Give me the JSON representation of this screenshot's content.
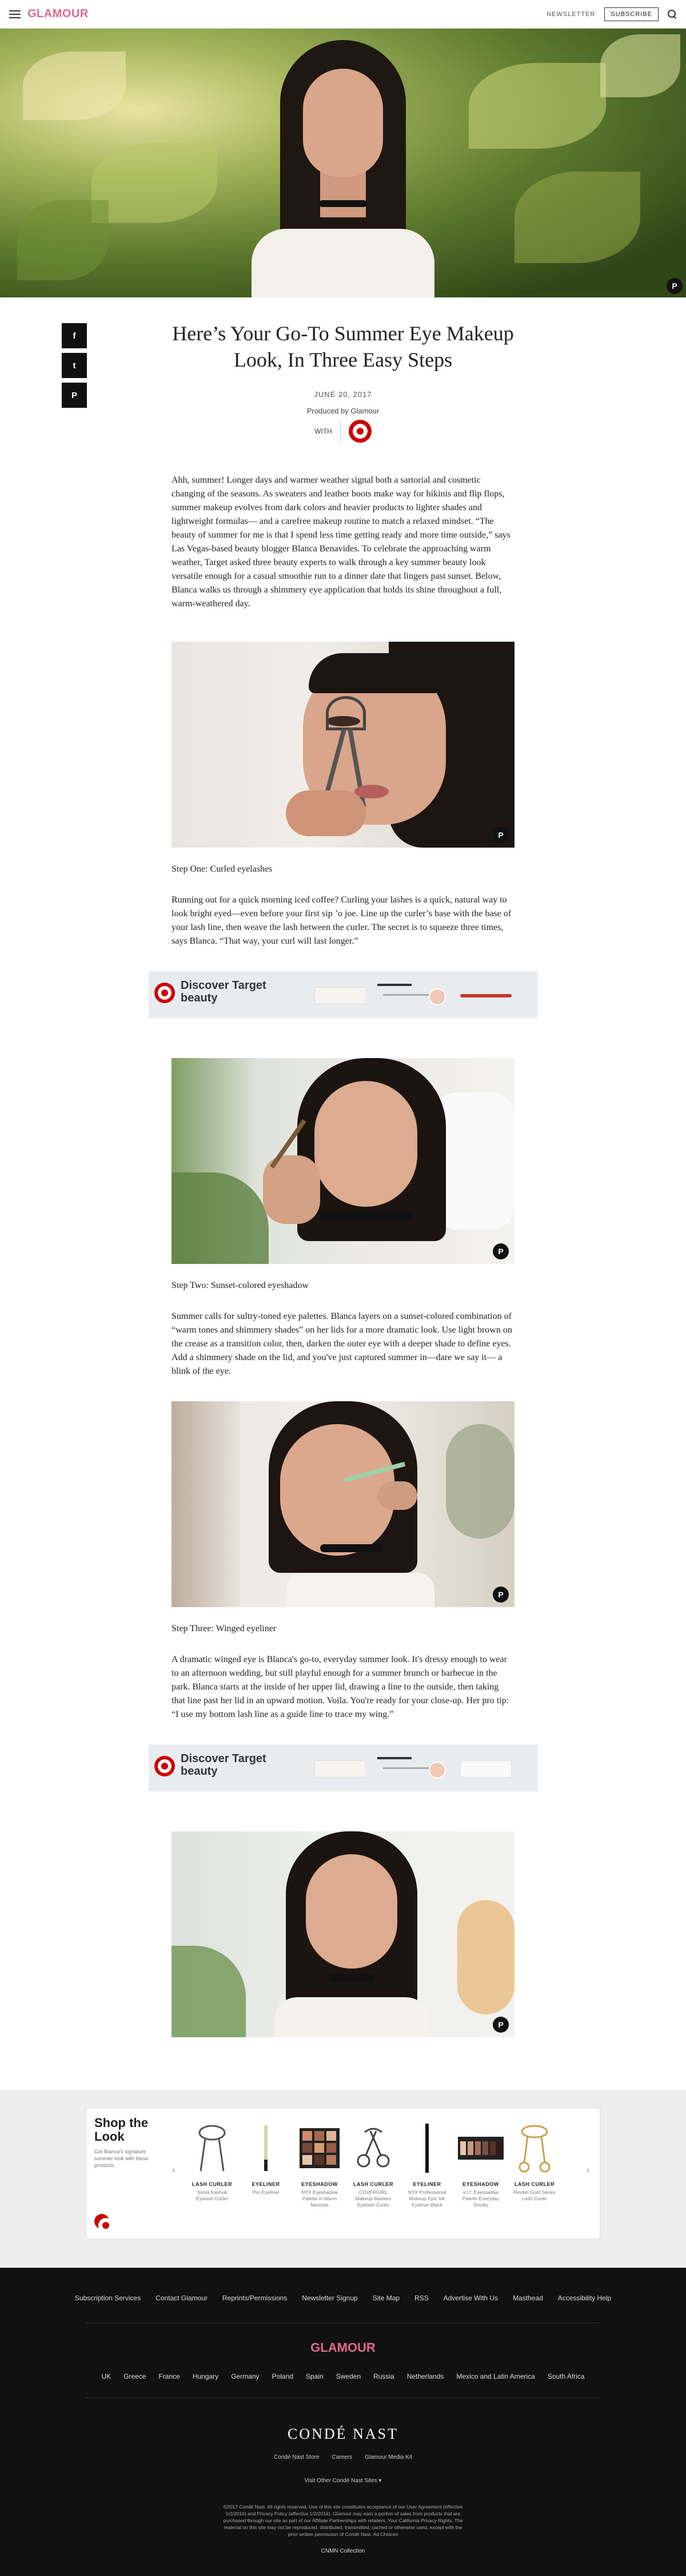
{
  "header": {
    "logo": "GLAMOUR",
    "newsletter_label": "NEWSLETTER",
    "subscribe_label": "SUBSCRIBE"
  },
  "article": {
    "title": "Here’s Your Go-To Summer Eye Makeup Look, In Three Easy Steps",
    "date": "JUNE 20, 2017",
    "produced_by": "Produced by Glamour",
    "with_label": "WITH",
    "intro": "Ahh, summer! Longer days and warmer weather signal both a sartorial and cosmetic changing of the seasons. As sweaters and leather boots make way for bikinis and flip flops, summer makeup evolves from dark colors and heavier products to lighter shades and lightweight formulas— and a carefree makeup routine to match a relaxed mindset. “The beauty of summer for me is that I spend less time getting ready and more time outside,” says Las Vegas-based beauty blogger Blanca Benavides. To celebrate the approaching warm weather, Target asked three beauty experts to walk through a key summer beauty look versatile enough for a casual smoothie run to a dinner date that lingers past sunset.  Below, Blanca walks us through a shimmery eye application that holds its shine throughout a full, warm-weathered day.",
    "steps": [
      {
        "caption": "Step One: Curled eyelashes",
        "text": "Running out for a quick morning iced coffee? Curling your lashes is a quick, natural way to look bright eyed—even before your first sip ’o joe.  Line up the curler’s base with the base of your lash line, then weave the lash between the curler. The secret is to squeeze three times, says Blanca. “That way, your curl will last longer.”"
      },
      {
        "caption": "Step Two: Sunset-colored eyeshadow",
        "text": "Summer calls for sultry-toned eye palettes. Blanca layers on a sunset-colored combination of “warm tones and shimmery shades” on her lids for a more dramatic look. Use light brown on the crease as a transition color, then, darken the outer eye with a deeper shade to define eyes. Add a shimmery shade on the lid, and you've just captured summer in—dare we say it— a blink of the eye."
      },
      {
        "caption": "Step Three: Winged eyeliner",
        "text": "A dramatic winged eye is Blanca's go-to, everyday summer look. It's dressy enough to wear to an afternoon wedding, but still playful enough for a summer brunch or barbecue in the park. Blanca starts at the inside of her upper lid, drawing a line to the outside, then taking that line past her lid in an upward motion. Voila. You're ready for your close-up. Her pro tip: “I use my bottom lash line as a guide line to trace my wing.”"
      }
    ]
  },
  "ad": {
    "text": "Discover Target beauty"
  },
  "shop": {
    "title": "Shop the Look",
    "subtitle": "Get Blanca's signature summer look with these products.",
    "items": [
      {
        "category": "LASH CURLER",
        "name": "Sonia Kashuk Eyelash Curler"
      },
      {
        "category": "EYELINER",
        "name": "Pixi Eyeliner"
      },
      {
        "category": "EYESHADOW",
        "name": "NYX Eyeshadow Palette in Warm Neutrals"
      },
      {
        "category": "LASH CURLER",
        "name": "COVERGIRL Makeup Masters Eyelash Curler"
      },
      {
        "category": "EYELINER",
        "name": "NYX Professional Makeup Epic Ink Eyeliner Black"
      },
      {
        "category": "EYESHADOW",
        "name": "e.l.f. Eyeshadow Palette Everyday Smoky"
      },
      {
        "category": "LASH CURLER",
        "name": "Revlon Gold Series Lash Curler"
      }
    ]
  },
  "footer": {
    "links": [
      "Subscription Services",
      "Contact Glamour",
      "Reprints/Permissions",
      "Newsletter Signup",
      "Site Map",
      "RSS",
      "Advertise With Us",
      "Masthead",
      "Accessibility Help"
    ],
    "logo": "GLAMOUR",
    "international": [
      "UK",
      "Greece",
      "France",
      "Hungary",
      "Germany",
      "Poland",
      "Spain",
      "Sweden",
      "Russia",
      "Netherlands",
      "Mexico and Latin America",
      "South Africa"
    ],
    "parent": "CONDÉ NAST",
    "parent_links": [
      "Condé Nast Store",
      "Careers",
      "Glamour Media Kit"
    ],
    "visit": "Visit Other Condé Nast Sites",
    "legal": "©2017 Condé Nast. All rights reserved. Use of this site constitutes acceptance of our User Agreement (effective 1/2/2016) and Privacy Policy (effective 1/2/2016). Glamour may earn a portion of sales from products that are purchased through our site as part of our Affiliate Partnerships with retailers. Your California Privacy Rights. The material on this site may not be reproduced, distributed, transmitted, cached or otherwise used, except with the prior written permission of Condé Nast. Ad Choices",
    "cnmn": "CNMN Collection"
  },
  "colors": {
    "brand_pink": "#e06a8e",
    "target_red": "#cc0000",
    "footer_bg": "#111111"
  },
  "icons": [
    "menu-icon",
    "search-icon",
    "facebook-icon",
    "twitter-icon",
    "pinterest-icon",
    "target-logo"
  ]
}
